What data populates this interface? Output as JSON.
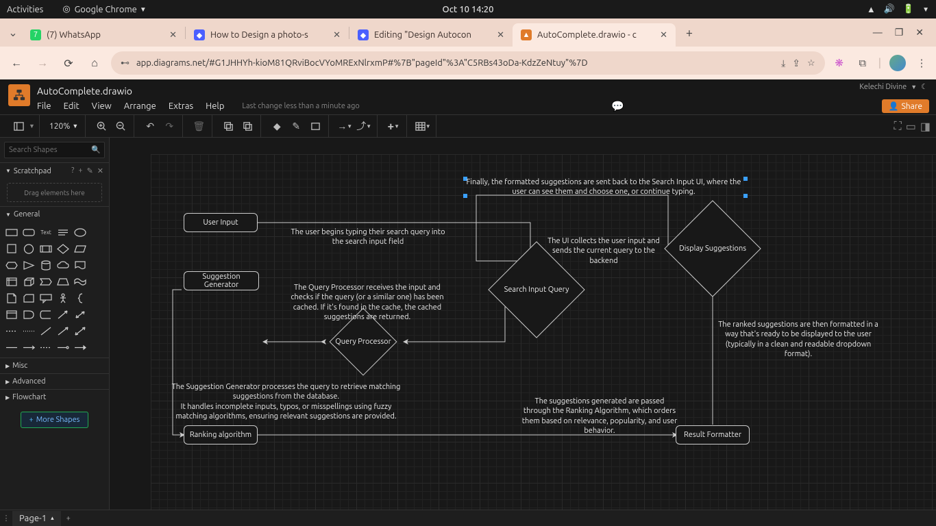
{
  "os_topbar": {
    "activities": "Activities",
    "app": "Google Chrome",
    "clock": "Oct 10  14:20"
  },
  "browser": {
    "tabs": [
      {
        "title": "(7) WhatsApp",
        "favicon_color": "#25d366",
        "favicon_text": "7"
      },
      {
        "title": "How to Design a photo-s",
        "favicon_color": "#4a5fff",
        "favicon_text": "◆"
      },
      {
        "title": "Editing \"Design Autocon",
        "favicon_color": "#4a5fff",
        "favicon_text": "◆"
      },
      {
        "title": "AutoComplete.drawio - c",
        "favicon_color": "#e07b2a",
        "favicon_text": "▲",
        "active": true
      }
    ],
    "url": "app.diagrams.net/#G1JHHYh-kioM81QRviBocVYoMRExNlrxmP#%7B\"pageId\"%3A\"C5RBs43oDa-KdzZeNtuy\"%7D"
  },
  "drawio": {
    "filename": "AutoComplete.drawio",
    "user": "Kelechi Divine",
    "menu": [
      "File",
      "Edit",
      "View",
      "Arrange",
      "Extras",
      "Help"
    ],
    "last_change": "Last change less than a minute ago",
    "share": "Share",
    "zoom": "120%",
    "search_placeholder": "Search Shapes",
    "scratchpad_label": "Scratchpad",
    "dropzone": "Drag elements here",
    "sections": {
      "general": "General",
      "misc": "Misc",
      "advanced": "Advanced",
      "flowchart": "Flowchart"
    },
    "more_shapes": "More Shapes",
    "page_tab": "Page-1"
  },
  "diagram": {
    "nodes": {
      "user_input": "User Input",
      "suggestion_generator": "Suggestion Generator",
      "ranking_algorithm": "Ranking algorithm",
      "result_formatter": "Result Formatter",
      "query_processor": "Query Processor",
      "search_input_query": "Search Input Query",
      "display_suggestions": "Display Suggestions"
    },
    "annots": {
      "a1": "Finally, the formatted suggestions are sent back to the Search Input UI, where the user can see them and choose one, or continue typing.",
      "a2": "The user begins typing their search query into the search input field",
      "a3": "The UI collects the user input and sends the current query to the backend",
      "a4": "The Query Processor receives the input and checks if the query (or a similar one) has been cached. If it's found in the cache, the cached suggestions are returned.",
      "a5": "The Suggestion Generator processes the query to retrieve matching suggestions from the database.\nIt handles incomplete inputs, typos, or misspellings using fuzzy matching algorithms, ensuring relevant suggestions are provided.",
      "a6": "The suggestions generated are passed through the Ranking Algorithm, which orders them based on relevance, popularity, and user behavior.",
      "a7": "The ranked suggestions are then formatted in a way that's ready to be displayed to the user (typically in a clean and readable dropdown format)."
    }
  }
}
